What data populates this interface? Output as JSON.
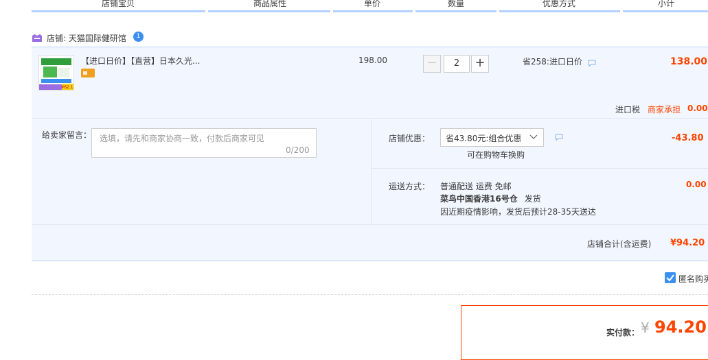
{
  "header": {
    "cols": [
      "店铺宝贝",
      "商品属性",
      "单价",
      "数量",
      "优惠方式",
      "小计"
    ]
  },
  "shop": {
    "label": "店铺: 天猫国际健研馆",
    "badge": "1"
  },
  "item": {
    "title": "【进口日价】【直营】日本久光...",
    "price": "198.00",
    "qty": "2",
    "qty_minus": "−",
    "qty_plus": "+",
    "promo": "省258:进口日价",
    "subtotal": "138.00",
    "thumb_badge": "¥62.1"
  },
  "tax": {
    "label": "进口税",
    "note": "商家承担",
    "value": "0.00"
  },
  "memo": {
    "label": "给卖家留言：",
    "placeholder": "选填，请先和商家协商一致，付款后商家可见",
    "count": "0/200"
  },
  "discount": {
    "label": "店铺优惠：",
    "selected": "省43.80元:组合优惠",
    "note": "可在购物车换购",
    "value": "-43.80"
  },
  "shipping": {
    "label": "运送方式：",
    "line1": "普通配送 运费 免邮",
    "warehouse": "菜鸟中国香港16号仓",
    "ship_word": "发货",
    "line3": "因近期疫情影响，发货后预计28-35天送达",
    "value": "0.00"
  },
  "total": {
    "label": "店铺合计(含运费)",
    "value": "¥94.20"
  },
  "anon": {
    "label": "匿名购买"
  },
  "pay": {
    "label": "实付款：",
    "yen": "¥",
    "value": "94.20"
  },
  "colors": {
    "accent": "#ff4400",
    "light_bg": "#f2f7ff",
    "border_blue": "#b2d1ff",
    "link_blue": "#3a8ff0"
  }
}
